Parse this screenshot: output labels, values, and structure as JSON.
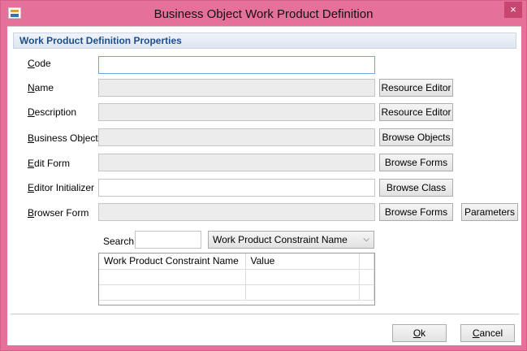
{
  "window": {
    "title": "Business Object Work Product Definition",
    "close_glyph": "×"
  },
  "section": {
    "title": "Work Product Definition Properties"
  },
  "fields": [
    {
      "label_key": "C",
      "label_rest": "ode",
      "value": "",
      "button": ""
    },
    {
      "label_key": "N",
      "label_rest": "ame",
      "value": "",
      "button": "Resource Editor"
    },
    {
      "label_key": "D",
      "label_rest": "escription",
      "value": "",
      "button": "Resource Editor"
    },
    {
      "label_key": "B",
      "label_rest": "usiness Object",
      "value": "",
      "button": "Browse Objects"
    },
    {
      "label_key": "E",
      "label_rest": "dit Form",
      "value": "",
      "button": "Browse Forms"
    },
    {
      "label_key": "E",
      "label_rest": "ditor Initializer",
      "value": "",
      "button": "Browse Class"
    },
    {
      "label_key": "B",
      "label_rest": "rowser Form",
      "value": "",
      "button": "Browse Forms",
      "extra_button": "Parameters"
    }
  ],
  "search": {
    "label": "Search",
    "value": "",
    "selected_field": "Work Product Constraint Name",
    "chevron": "⌵"
  },
  "constraints_table": {
    "columns": [
      "Work Product Constraint Name",
      "Value"
    ],
    "rows": []
  },
  "footer": {
    "ok_key": "O",
    "ok_rest": "k",
    "cancel_key": "C",
    "cancel_rest": "ancel"
  },
  "colors": {
    "titlebar": "#e5709a",
    "section_text": "#1d4f8a",
    "focus_border": "#74a3d9"
  }
}
